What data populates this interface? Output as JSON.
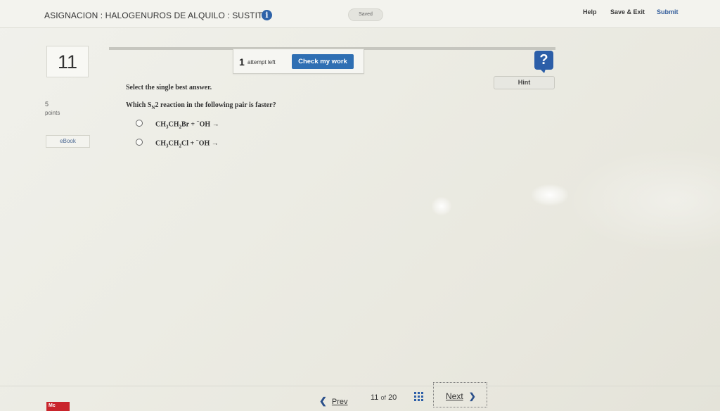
{
  "header": {
    "title": "ASIGNACION : HALOGENUROS DE ALQUILO : SUSTIT...",
    "info_icon": "info-icon",
    "saved_status": "Saved",
    "help_label": "Help",
    "save_exit_label": "Save & Exit",
    "submit_label": "Submit"
  },
  "question_meta": {
    "number": "11",
    "points_value": "5",
    "points_label": "points",
    "ebook_label": "eBook"
  },
  "toolbar": {
    "attempts_count": "1",
    "attempts_text": "attempt left",
    "check_label": "Check my work",
    "help_icon_glyph": "?",
    "hint_label": "Hint"
  },
  "question": {
    "instruction": "Select the single best answer.",
    "prompt_prefix": "Which S",
    "prompt_sub": "N",
    "prompt_suffix": "2 reaction in the following pair is faster?",
    "options": [
      {
        "part1": "CH",
        "sub1": "3",
        "part2": "CH",
        "sub2": "2",
        "part3": "Br + ",
        "sup": "−",
        "part4": "OH →"
      },
      {
        "part1": "CH",
        "sub1": "3",
        "part2": "CH",
        "sub2": "2",
        "part3": "Cl + ",
        "sup": "−",
        "part4": "OH →"
      }
    ]
  },
  "pagination": {
    "prev_label": "Prev",
    "current": "11",
    "of_label": "of",
    "total": "20",
    "next_label": "Next"
  },
  "footer": {
    "logo_text": "Mc"
  },
  "colors": {
    "accent": "#2f6fb3",
    "help_icon_bg": "#2c5ea8",
    "logo_red": "#c9252c"
  }
}
